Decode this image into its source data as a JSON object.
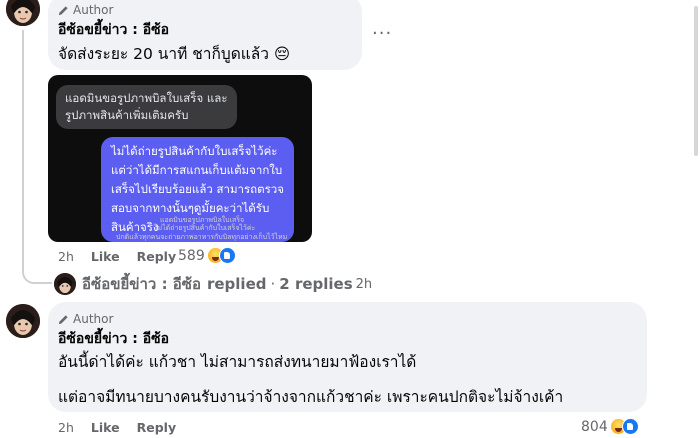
{
  "comment1": {
    "author_badge": "Author",
    "name": "อีซ้อขยี้ข่าว : อีซ้อ",
    "text": "จัดส่งระยะ 20 นาที ชาก็บูดแล้ว 😔",
    "more": "...",
    "time": "2h",
    "like_label": "Like",
    "reply_label": "Reply",
    "reaction_count": "589",
    "reactions": [
      "haha",
      "like"
    ],
    "image": {
      "bubble_gray": "แอดมินขอรูปภาพบิลใบเสร็จ และ\nรูปภาพสินค้าเพิ่มเติมครับ",
      "bubble_blue": "ไม่ได้ถ่ายรูปสินค้ากับใบเสร็จไว้ค่ะ\nแต่ว่าได้มีการสแกนเก็บแต้มจากใบ\nเสร็จไปเรียบร้อยแล้ว สามารถตรวจ\nสอบจากทางนั้นๆดูมั้ยคะว่าได้รับ\nสินค้าจริง",
      "caption_1": "แอดมินขอรูปภาพบิลใบเสร็จ",
      "caption_2": "ไม่ได้ถ่ายรูปสินค้ากับใบเสร็จไว้ค่ะ",
      "caption_3": "ปกติแล้วทุกคนจะถ่ายภาพอาหารกับบิลทุกอย่างเก็บไว้ไหม"
    }
  },
  "replies_row": {
    "name": "อีซ้อขยี้ข่าว : อีซ้อ",
    "replied_label": "replied",
    "separator": "·",
    "replies_count": "2 replies",
    "time": "2h"
  },
  "comment2": {
    "author_badge": "Author",
    "name": "อีซ้อขยี้ข่าว : อีซ้อ",
    "line1": "อันนี้ด่าได้ค่ะ แก้วชา ไม่สามารถส่งทนายมาฟ้องเราได้",
    "line2": "แต่อาจมีทนายบางคนรับงานว่าจ้างจากแก้วชาค่ะ เพราะคนปกติจะไม่จ้างเค้า",
    "time": "2h",
    "like_label": "Like",
    "reply_label": "Reply",
    "reaction_count": "804",
    "reactions": [
      "haha",
      "like"
    ]
  },
  "colors": {
    "bubble_bg": "#f0f2f5",
    "meta_text": "#65676b",
    "like_blue": "#1877f2",
    "chat_blue": "#5b5ef0"
  }
}
